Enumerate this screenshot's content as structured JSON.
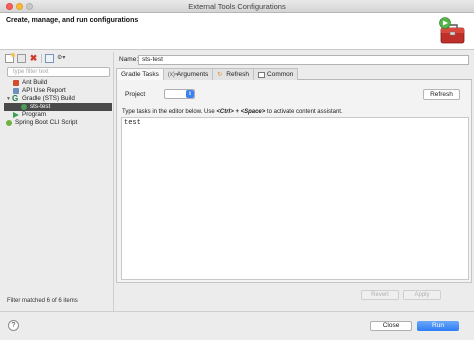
{
  "window": {
    "title": "External Tools Configurations"
  },
  "banner": {
    "title": "Create, manage, and run configurations",
    "icon": "toolbox-icon"
  },
  "left": {
    "toolbar": [
      "new-config-icon",
      "duplicate-icon",
      "delete-icon",
      "collapse-all-icon",
      "filter-icon"
    ],
    "filter_placeholder": "type filter text",
    "tree": [
      {
        "label": "Ant Build",
        "icon": "ant-icon"
      },
      {
        "label": "API Use Report",
        "icon": "api-icon"
      },
      {
        "label": "Gradle (STS) Build",
        "icon": "gradle-icon"
      },
      {
        "label": "sts-test",
        "icon": "sts-icon"
      },
      {
        "label": "Program",
        "icon": "program-icon"
      },
      {
        "label": "Spring Boot CLI Script",
        "icon": "spring-icon"
      }
    ],
    "status": "Filter matched 6 of 6 items"
  },
  "right": {
    "name_label": "Name:",
    "name_value": "sts-test",
    "tabs": [
      {
        "label": "Gradle Tasks"
      },
      {
        "label": "Arguments"
      },
      {
        "label": "Refresh"
      },
      {
        "label": "Common"
      }
    ],
    "project_label": "Project",
    "project_value": "",
    "refresh_button": "Refresh",
    "hint_prefix": "Type tasks in the editor below. Use ",
    "hint_keys": "<Ctrl> + <Space>",
    "hint_suffix": " to activate content assistant.",
    "editor_text": "test",
    "revert_button": "Revert",
    "apply_button": "Apply"
  },
  "footer": {
    "help": "?",
    "close_button": "Close",
    "run_button": "Run"
  },
  "colors": {
    "accent": "#2e7cf6",
    "selection": "#4a4a4a"
  }
}
